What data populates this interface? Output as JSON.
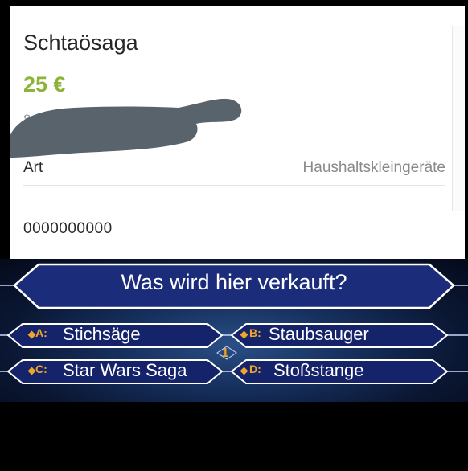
{
  "listing": {
    "title": "Schtaösaga",
    "price": "25 €",
    "ref_partial": "8",
    "attribute": {
      "label": "Art",
      "value": "Haushaltskleingeräte"
    },
    "item_number": "0000000000"
  },
  "quiz": {
    "question": "Was wird hier verkauft?",
    "level": "1",
    "answers": [
      {
        "letter": "A:",
        "text": "Stichsäge"
      },
      {
        "letter": "B:",
        "text": "Staubsauger"
      },
      {
        "letter": "C:",
        "text": "Star Wars Saga"
      },
      {
        "letter": "D:",
        "text": "Stoßstange"
      }
    ]
  },
  "colors": {
    "price_green": "#8db33a",
    "redaction": "#59636c",
    "panel_blue": "#1b2d7a",
    "panel_border": "#ffffff",
    "answer_letter": "#f0a62a"
  }
}
